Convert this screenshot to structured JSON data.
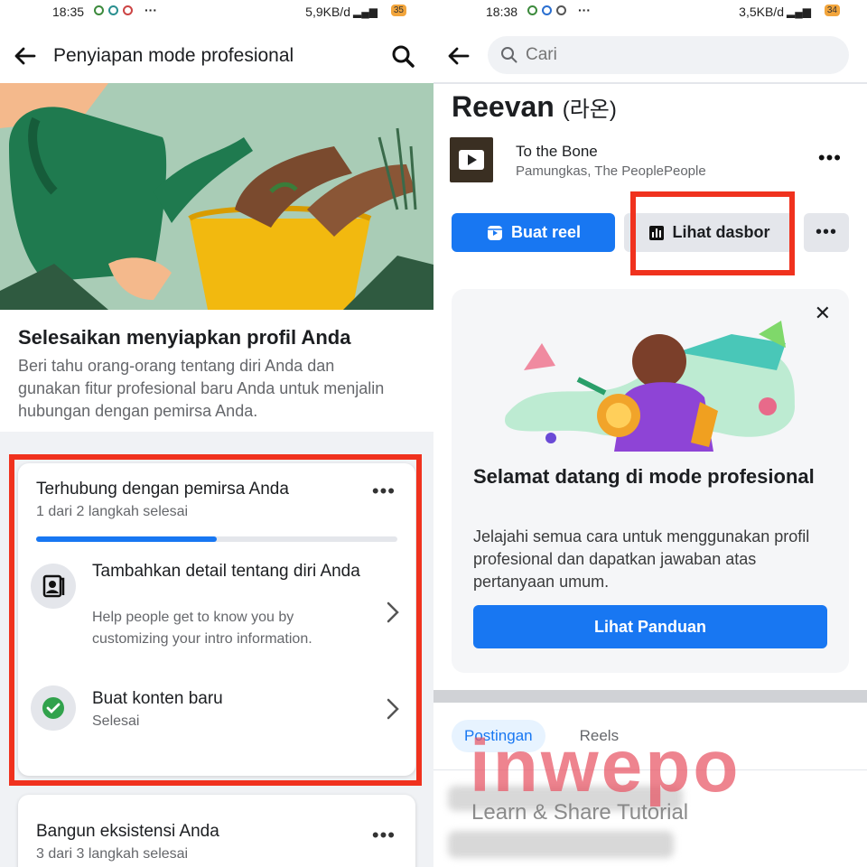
{
  "left": {
    "status": {
      "time": "18:35",
      "network": "5,9KB/d",
      "battery": "35"
    },
    "header": {
      "title": "Penyiapan mode profesional"
    },
    "setup": {
      "title": "Selesaikan menyiapkan profil Anda",
      "description": "Beri tahu orang-orang tentang diri Anda dan gunakan fitur profesional baru Anda untuk menjalin hubungan dengan pemirsa Anda."
    },
    "card1": {
      "title": "Terhubung dengan pemirsa Anda",
      "progress_text": "1 dari 2 langkah selesai",
      "progress": 0.5,
      "items": [
        {
          "title": "Tambahkan detail tentang diri Anda",
          "subtitle": "Help people get to know you by customizing your intro information."
        },
        {
          "title": "Buat konten baru",
          "subtitle": "Selesai"
        }
      ]
    },
    "card2": {
      "title": "Bangun eksistensi Anda",
      "progress_text": "3 dari 3 langkah selesai"
    }
  },
  "right": {
    "status": {
      "time": "18:38",
      "network": "3,5KB/d",
      "battery": "34"
    },
    "search": {
      "placeholder": "Cari"
    },
    "profile": {
      "name": "Reevan",
      "alt_name": "(라온)"
    },
    "music": {
      "song": "To the Bone",
      "artist": "Pamungkas, The PeoplePeople"
    },
    "buttons": {
      "reel": "Buat reel",
      "dashboard": "Lihat dasbor",
      "more": "•••"
    },
    "welcome": {
      "title": "Selamat datang di mode profesional",
      "description": "Jelajahi semua cara untuk menggunakan profil profesional dan dapatkan jawaban atas pertanyaan umum.",
      "button": "Lihat Panduan"
    },
    "tabs": [
      "Postingan",
      "Reels"
    ]
  },
  "watermark": {
    "brand": "inwepo",
    "tagline": "Learn & Share Tutorial"
  },
  "colors": {
    "accent": "#1877f2",
    "highlight": "#f0321e",
    "success": "#31a24c"
  }
}
